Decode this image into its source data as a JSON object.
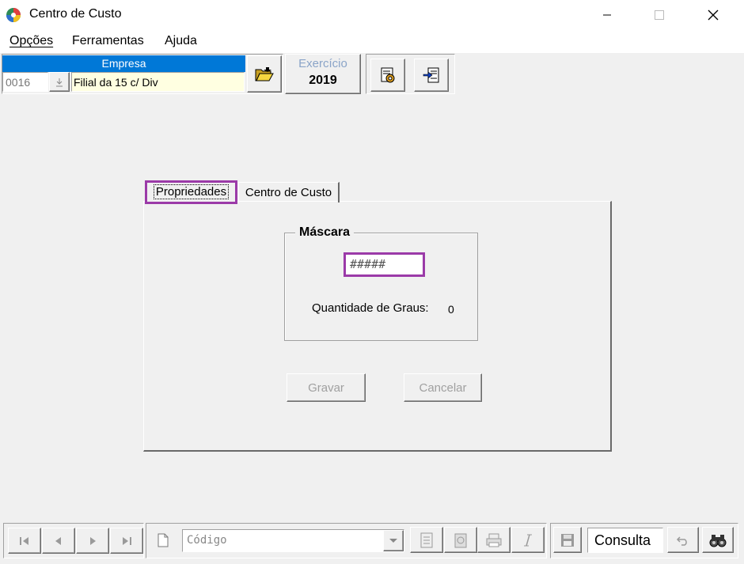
{
  "window": {
    "title": "Centro de Custo"
  },
  "menu": {
    "items": [
      "Opções",
      "Ferramentas",
      "Ajuda"
    ]
  },
  "empresa": {
    "header": "Empresa",
    "code": "0016",
    "name": "Filial da 15  c/ Div"
  },
  "exercicio": {
    "label": "Exercício",
    "value": "2019"
  },
  "tabs": [
    {
      "label": "Propriedades",
      "selected": true
    },
    {
      "label": "Centro de Custo",
      "selected": false
    }
  ],
  "mascara": {
    "legend": "Máscara",
    "value": "#####",
    "graus_label": "Quantidade de Graus:",
    "graus_value": "0"
  },
  "buttons": {
    "gravar": "Gravar",
    "cancelar": "Cancelar"
  },
  "bottombar": {
    "search_field": "Código",
    "mode": "Consulta"
  },
  "colors": {
    "highlight": "#9b3aa8",
    "empresa_header": "#0078d7",
    "empresa_name_bg": "#ffffe1"
  }
}
